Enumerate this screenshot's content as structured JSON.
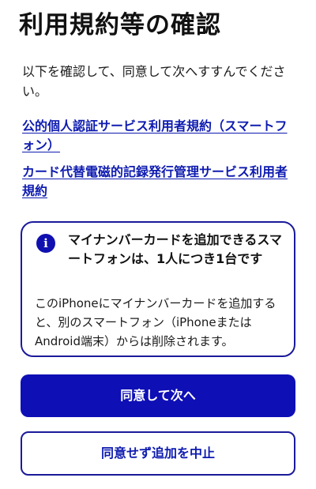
{
  "page": {
    "title": "利用規約等の確認",
    "instructions": "以下を確認して、同意して次へすすんでください。"
  },
  "links": [
    {
      "label": "公的個人認証サービス利用者規約（スマートフォン）"
    },
    {
      "label": "カード代替電磁的記録発行管理サービス利用者規約"
    }
  ],
  "notice": {
    "icon": "info-icon",
    "icon_glyph": "i",
    "heading": "マイナンバーカードを追加できるスマートフォンは、1人につき1台です",
    "body": "このiPhoneにマイナンバーカードを追加すると、別のスマートフォン（iPhoneまたはAndroid端末）からは削除されます。"
  },
  "buttons": {
    "primary_label": "同意して次へ",
    "secondary_label": "同意せず追加を中止"
  },
  "colors": {
    "accent": "#0e0fb5",
    "link": "#0e1bb0",
    "border": "#1a1a9a"
  }
}
